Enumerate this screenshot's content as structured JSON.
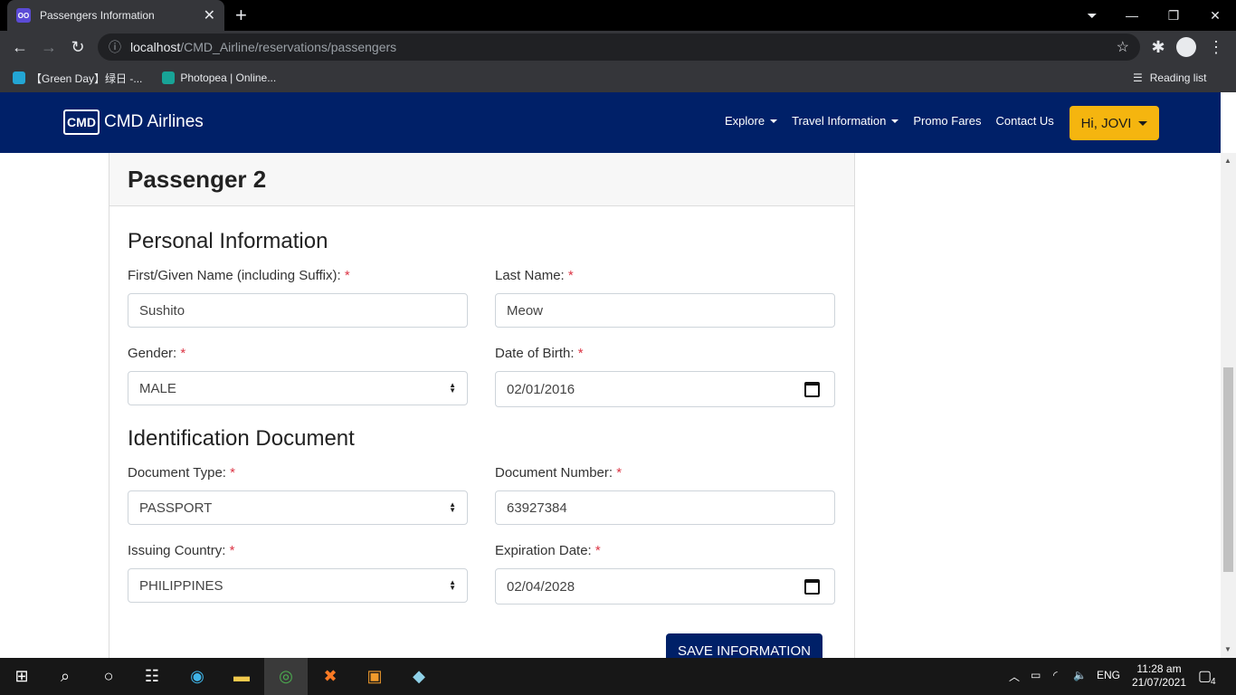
{
  "browser": {
    "tab_title": "Passengers Information",
    "url_host": "localhost",
    "url_path": "/CMD_Airline/reservations/passengers",
    "bookmarks": [
      "【Green Day】绿日 -...",
      "Photopea | Online..."
    ],
    "reading_list": "Reading list"
  },
  "navbar": {
    "brand": "CMD Airlines",
    "logo_text": "CMD",
    "links": [
      "Explore",
      "Travel Information",
      "Promo Fares",
      "Contact Us"
    ],
    "user_button": "Hi, JOVI"
  },
  "card": {
    "title": "Passenger 2",
    "personal_section": "Personal Information",
    "first_name_label": "First/Given Name (including Suffix):",
    "first_name_value": "Sushito",
    "last_name_label": "Last Name:",
    "last_name_value": "Meow",
    "gender_label": "Gender:",
    "gender_value": "MALE",
    "dob_label": "Date of Birth:",
    "dob_value": "02/01/2016",
    "id_section": "Identification Document",
    "doc_type_label": "Document Type:",
    "doc_type_value": "PASSPORT",
    "doc_number_label": "Document Number:",
    "doc_number_value": "63927384",
    "country_label": "Issuing Country:",
    "country_value": "PHILIPPINES",
    "expiry_label": "Expiration Date:",
    "expiry_value": "02/04/2028",
    "required_mark": "*",
    "save_button": "SAVE INFORMATION"
  },
  "taskbar": {
    "language": "ENG",
    "time": "11:28 am",
    "date": "21/07/2021",
    "notifications": "4"
  },
  "colors": {
    "navbar": "#002068",
    "user_button": "#f5b50f",
    "required": "#dc3545"
  }
}
